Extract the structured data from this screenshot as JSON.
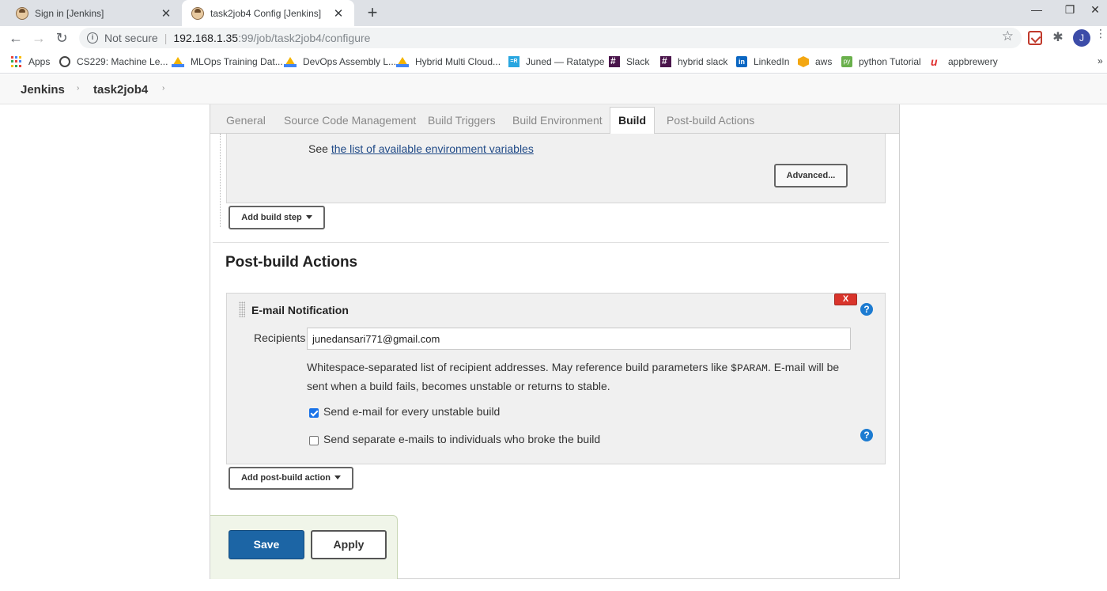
{
  "browser": {
    "tabs": [
      {
        "title": "Sign in [Jenkins]",
        "close": "✕"
      },
      {
        "title": "task2job4 Config [Jenkins]",
        "close": "✕"
      }
    ],
    "new_tab": "+",
    "window_controls": {
      "minimize": "—",
      "maximize": "❐",
      "close": "✕"
    },
    "nav": {
      "back": "←",
      "forward": "→",
      "reload": "↻"
    },
    "address": {
      "security_icon": "i",
      "security": "Not secure",
      "separator": "|",
      "host": "192.168.1.35",
      "path": ":99/job/task2job4/configure"
    },
    "star": "☆",
    "avatar_letter": "J",
    "menu": "⋮",
    "bookmarks": [
      {
        "label": "Apps",
        "icon": "apps-icon"
      },
      {
        "label": "CS229: Machine Le...",
        "icon": "globe-icon"
      },
      {
        "label": "MLOps Training Dat...",
        "icon": "drive-icon"
      },
      {
        "label": "DevOps Assembly L...",
        "icon": "drive-icon"
      },
      {
        "label": "Hybrid Multi Cloud...",
        "icon": "drive-icon"
      },
      {
        "label": "Juned — Ratatype",
        "icon": "ratatype-icon"
      },
      {
        "label": "Slack",
        "icon": "slack-icon"
      },
      {
        "label": "hybrid slack",
        "icon": "slack-icon"
      },
      {
        "label": "LinkedIn",
        "icon": "linkedin-icon"
      },
      {
        "label": "aws",
        "icon": "aws-icon"
      },
      {
        "label": "python Tutorial",
        "icon": "python-icon"
      },
      {
        "label": "appbrewery",
        "icon": "appbrewery-icon"
      }
    ],
    "bookmarks_more": "»"
  },
  "breadcrumb": {
    "items": [
      "Jenkins",
      "task2job4"
    ],
    "sep": "›"
  },
  "config": {
    "tabs": [
      "General",
      "Source Code Management",
      "Build Triggers",
      "Build Environment",
      "Build",
      "Post-build Actions"
    ],
    "active_tab": "Build",
    "build_step": {
      "see_prefix": "See ",
      "see_link": "the list of available environment variables",
      "advanced_label": "Advanced..."
    },
    "add_build_step_label": "Add build step",
    "post_build_title": "Post-build Actions",
    "email": {
      "title": "E-mail Notification",
      "delete_label": "X",
      "help": "?",
      "recipients_label": "Recipients",
      "recipients_value": "junedansari771@gmail.com",
      "help_text_1": "Whitespace-separated list of recipient addresses. May reference build parameters like ",
      "help_code": "$PARAM",
      "help_text_2": ". E-mail will be sent when a build fails, becomes unstable or returns to stable.",
      "checkbox_unstable": {
        "label": "Send e-mail for every unstable build",
        "checked": true
      },
      "checkbox_individuals": {
        "label": "Send separate e-mails to individuals who broke the build",
        "checked": false
      }
    },
    "add_post_build_label": "Add post-build action",
    "save_label": "Save",
    "apply_label": "Apply"
  },
  "colors": {
    "save_button": "#1c65a5",
    "delete_button": "#d9342b",
    "help_icon": "#1c7bd1",
    "link": "#204a87"
  }
}
